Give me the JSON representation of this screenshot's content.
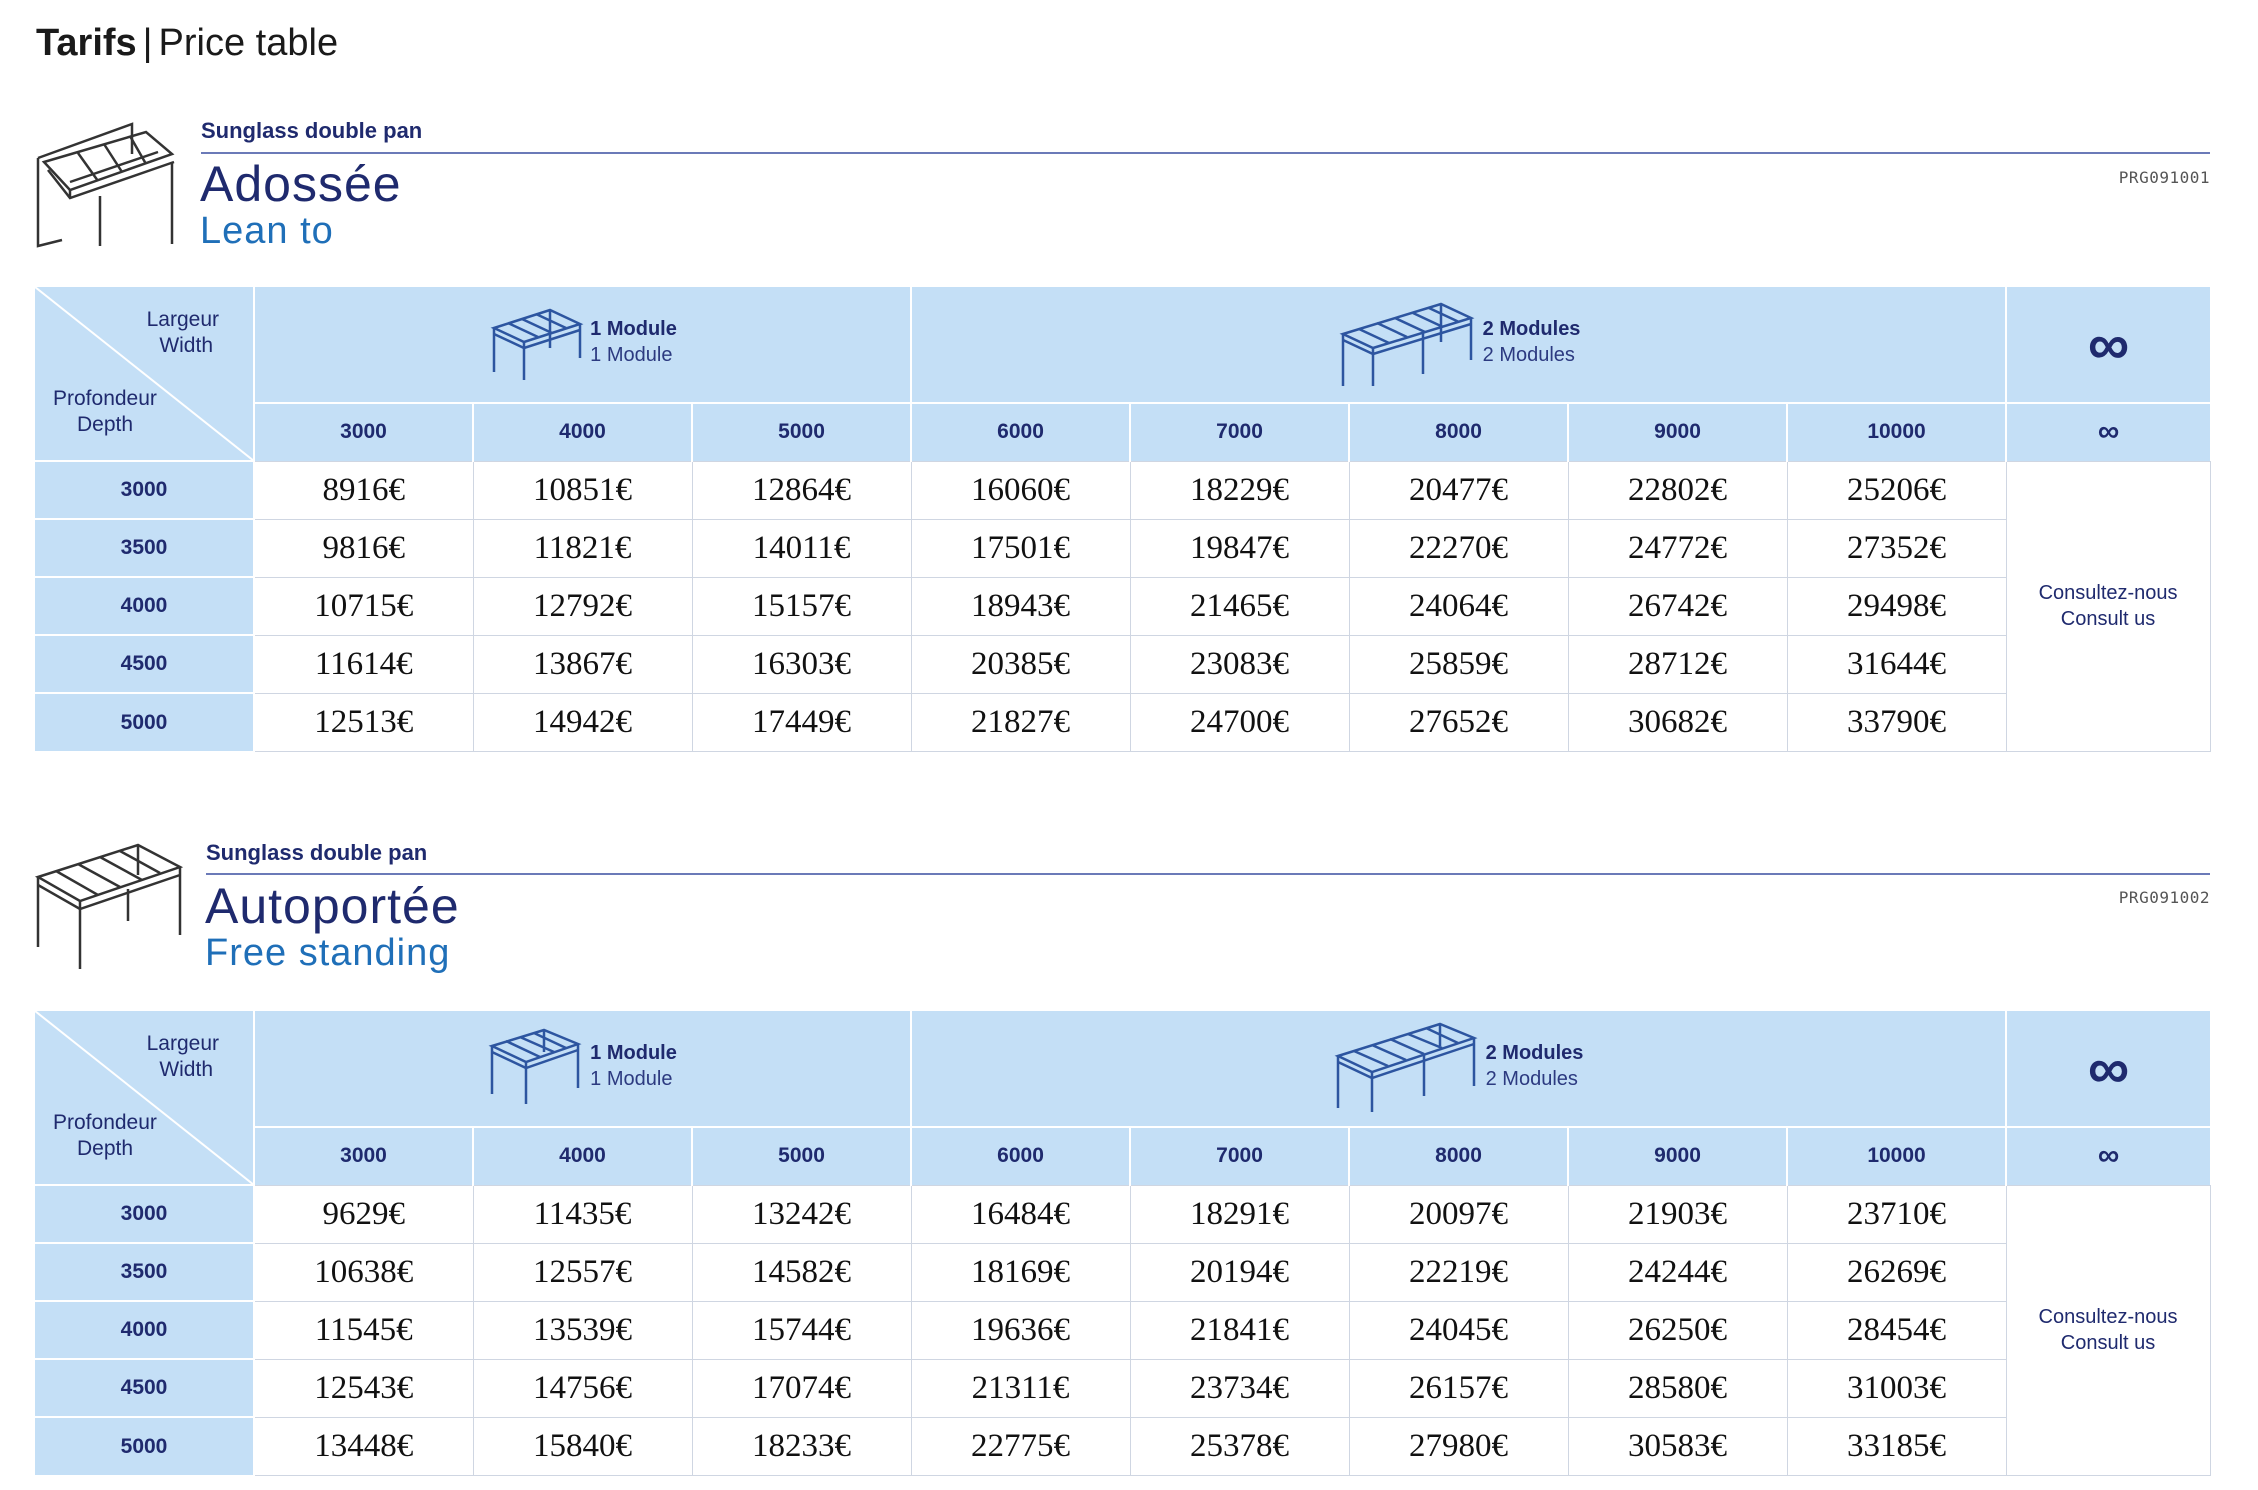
{
  "page": {
    "title_bold": "Tarifs",
    "title_separator": "|",
    "title_rest": "Price table"
  },
  "sections": [
    {
      "icon": "lean-to-pergola-icon",
      "subtitle": "Sunglass double pan",
      "title_fr": "Adossée",
      "title_en": "Lean to",
      "ref": "PRG091001",
      "table": {
        "corner": {
          "largeur_fr": "Largeur",
          "largeur_en": "Width",
          "profondeur_fr": "Profondeur",
          "profondeur_en": "Depth"
        },
        "group1": {
          "label_fr": "1 Module",
          "label_en": "1 Module",
          "icon": "lean-to-module-icon"
        },
        "group2": {
          "label_fr": "2 Modules",
          "label_en": "2 Modules",
          "icon": "lean-to-two-modules-icon"
        },
        "infinity_header": "∞",
        "columns": [
          "3000",
          "4000",
          "5000",
          "6000",
          "7000",
          "8000",
          "9000",
          "10000",
          "∞"
        ],
        "rows": [
          {
            "depth": "3000",
            "prices": [
              "8916€",
              "10851€",
              "12864€",
              "16060€",
              "18229€",
              "20477€",
              "22802€",
              "25206€"
            ]
          },
          {
            "depth": "3500",
            "prices": [
              "9816€",
              "11821€",
              "14011€",
              "17501€",
              "19847€",
              "22270€",
              "24772€",
              "27352€"
            ]
          },
          {
            "depth": "4000",
            "prices": [
              "10715€",
              "12792€",
              "15157€",
              "18943€",
              "21465€",
              "24064€",
              "26742€",
              "29498€"
            ]
          },
          {
            "depth": "4500",
            "prices": [
              "11614€",
              "13867€",
              "16303€",
              "20385€",
              "23083€",
              "25859€",
              "28712€",
              "31644€"
            ]
          },
          {
            "depth": "5000",
            "prices": [
              "12513€",
              "14942€",
              "17449€",
              "21827€",
              "24700€",
              "27652€",
              "30682€",
              "33790€"
            ]
          }
        ],
        "consult_fr": "Consultez-nous",
        "consult_en": "Consult us"
      }
    },
    {
      "icon": "free-standing-pergola-icon",
      "subtitle": "Sunglass double pan",
      "title_fr": "Autoportée",
      "title_en": "Free standing",
      "ref": "PRG091002",
      "table": {
        "corner": {
          "largeur_fr": "Largeur",
          "largeur_en": "Width",
          "profondeur_fr": "Profondeur",
          "profondeur_en": "Depth"
        },
        "group1": {
          "label_fr": "1 Module",
          "label_en": "1 Module",
          "icon": "free-standing-module-icon"
        },
        "group2": {
          "label_fr": "2 Modules",
          "label_en": "2 Modules",
          "icon": "free-standing-two-modules-icon"
        },
        "infinity_header": "∞",
        "columns": [
          "3000",
          "4000",
          "5000",
          "6000",
          "7000",
          "8000",
          "9000",
          "10000",
          "∞"
        ],
        "rows": [
          {
            "depth": "3000",
            "prices": [
              "9629€",
              "11435€",
              "13242€",
              "16484€",
              "18291€",
              "20097€",
              "21903€",
              "23710€"
            ]
          },
          {
            "depth": "3500",
            "prices": [
              "10638€",
              "12557€",
              "14582€",
              "18169€",
              "20194€",
              "22219€",
              "24244€",
              "26269€"
            ]
          },
          {
            "depth": "4000",
            "prices": [
              "11545€",
              "13539€",
              "15744€",
              "19636€",
              "21841€",
              "24045€",
              "26250€",
              "28454€"
            ]
          },
          {
            "depth": "4500",
            "prices": [
              "12543€",
              "14756€",
              "17074€",
              "21311€",
              "23734€",
              "26157€",
              "28580€",
              "31003€"
            ]
          },
          {
            "depth": "5000",
            "prices": [
              "13448€",
              "15840€",
              "18233€",
              "22775€",
              "25378€",
              "27980€",
              "30583€",
              "33185€"
            ]
          }
        ],
        "consult_fr": "Consultez-nous",
        "consult_en": "Consult us"
      }
    }
  ]
}
